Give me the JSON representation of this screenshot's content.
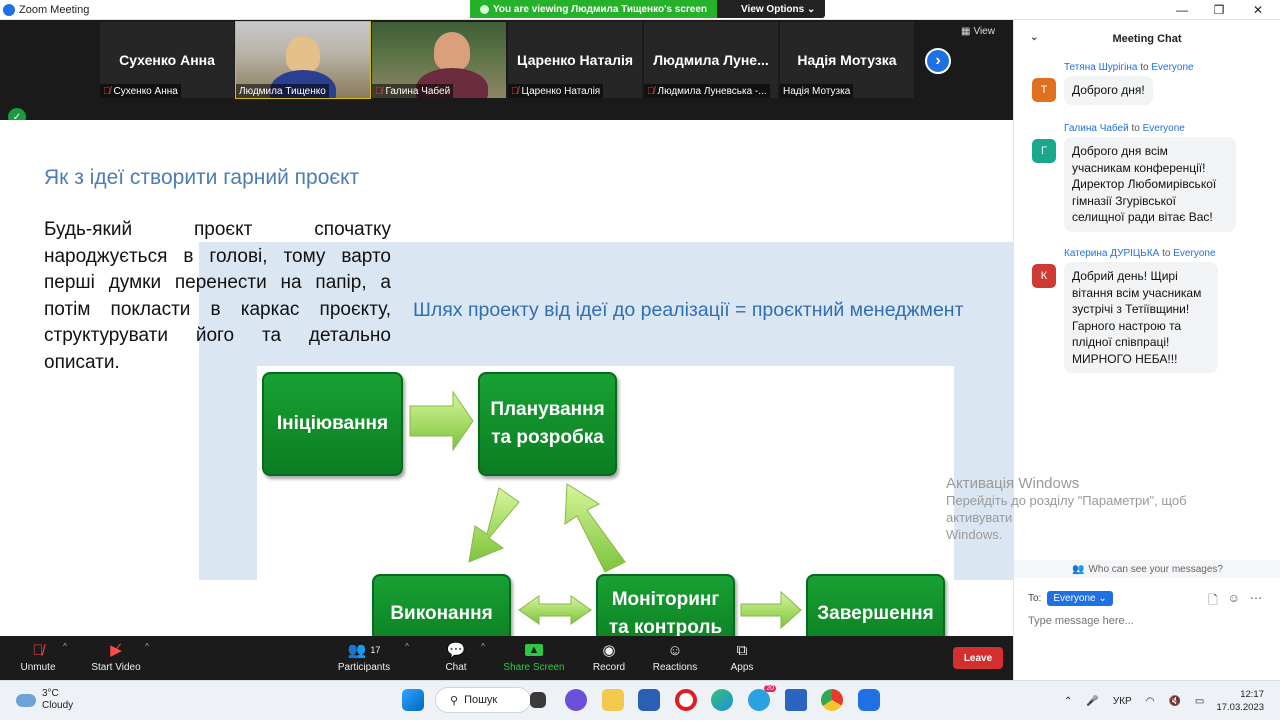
{
  "window": {
    "title": "Zoom Meeting",
    "minimize": "—",
    "maximize": "❐",
    "close": "✕"
  },
  "share_banner": {
    "status": "You are viewing Людмила Тищенко's screen",
    "view_options": "View Options ⌄"
  },
  "gallery": {
    "view_label": "View",
    "tiles": [
      {
        "big": "Сухенко Анна",
        "label": "Сухенко Анна",
        "muted": true
      },
      {
        "big": "",
        "label": "Людмила Тищенко",
        "muted": false
      },
      {
        "big": "",
        "label": "Галина Чабей",
        "muted": true
      },
      {
        "big": "Царенко Наталія",
        "label": "Царенко Наталія",
        "muted": true
      },
      {
        "big": "Людмила Луне...",
        "label": "Людмила Луневська -...",
        "muted": true
      },
      {
        "big": "Надія Мотузка",
        "label": "Надія Мотузка",
        "muted": false
      }
    ]
  },
  "slide": {
    "title": "Як з ідеї створити гарний проєкт",
    "body": "Будь-який проєкт спочатку народжується в голові, тому варто перші думки перенести на папір, а потім покласти в каркас проєкту, структурувати його та детально описати.",
    "blue_title": "Шлях проекту від ідеї до реалізації = проєктний менеджмент",
    "boxes": {
      "init": "Ініціювання",
      "plan": "Планування та розробка",
      "exec": "Виконання",
      "monitor": "Моніторинг та контроль",
      "finish": "Завершення"
    }
  },
  "watermark": {
    "line1": "Активація Windows",
    "line2": "Перейдіть до розділу \"Параметри\", щоб активувати",
    "line3": "Windows."
  },
  "chat": {
    "title": "Meeting Chat",
    "to_word": "to",
    "messages": [
      {
        "sender": "Тетяна Шурігіна",
        "recipient": "Everyone",
        "initial": "Т",
        "color": "#e0701f",
        "text": "Доброго дня!"
      },
      {
        "sender": "Галина Чабей",
        "recipient": "Everyone",
        "initial": "Г",
        "color": "#1aa88c",
        "text": "Доброго дня всім учасникам конференції! Директор Любомирівської гімназії Згурівської селищної ради вітає Вас!"
      },
      {
        "sender": "Катерина ДУРІЦЬКА",
        "recipient": "Everyone",
        "initial": "К",
        "color": "#d03a35",
        "text": "Добрий день! Щирі вітання всім учасникам зустрічі з Тетіївщини! Гарного настрою та плідної співпраці! МИРНОГО НЕБА!!!"
      }
    ],
    "who_can_see": "Who can see your messages?",
    "to_label": "To:",
    "to_value": "Everyone",
    "placeholder": "Type message here..."
  },
  "toolbar": {
    "unmute": "Unmute",
    "start_video": "Start Video",
    "participants": "Participants",
    "participants_count": "17",
    "chat": "Chat",
    "share_screen": "Share Screen",
    "record": "Record",
    "reactions": "Reactions",
    "apps": "Apps",
    "leave": "Leave"
  },
  "taskbar": {
    "temperature": "3°C",
    "weather": "Cloudy",
    "search": "Пошук",
    "language": "УКР",
    "time": "12:17",
    "date": "17.03.2023",
    "notif_badge": "20"
  }
}
